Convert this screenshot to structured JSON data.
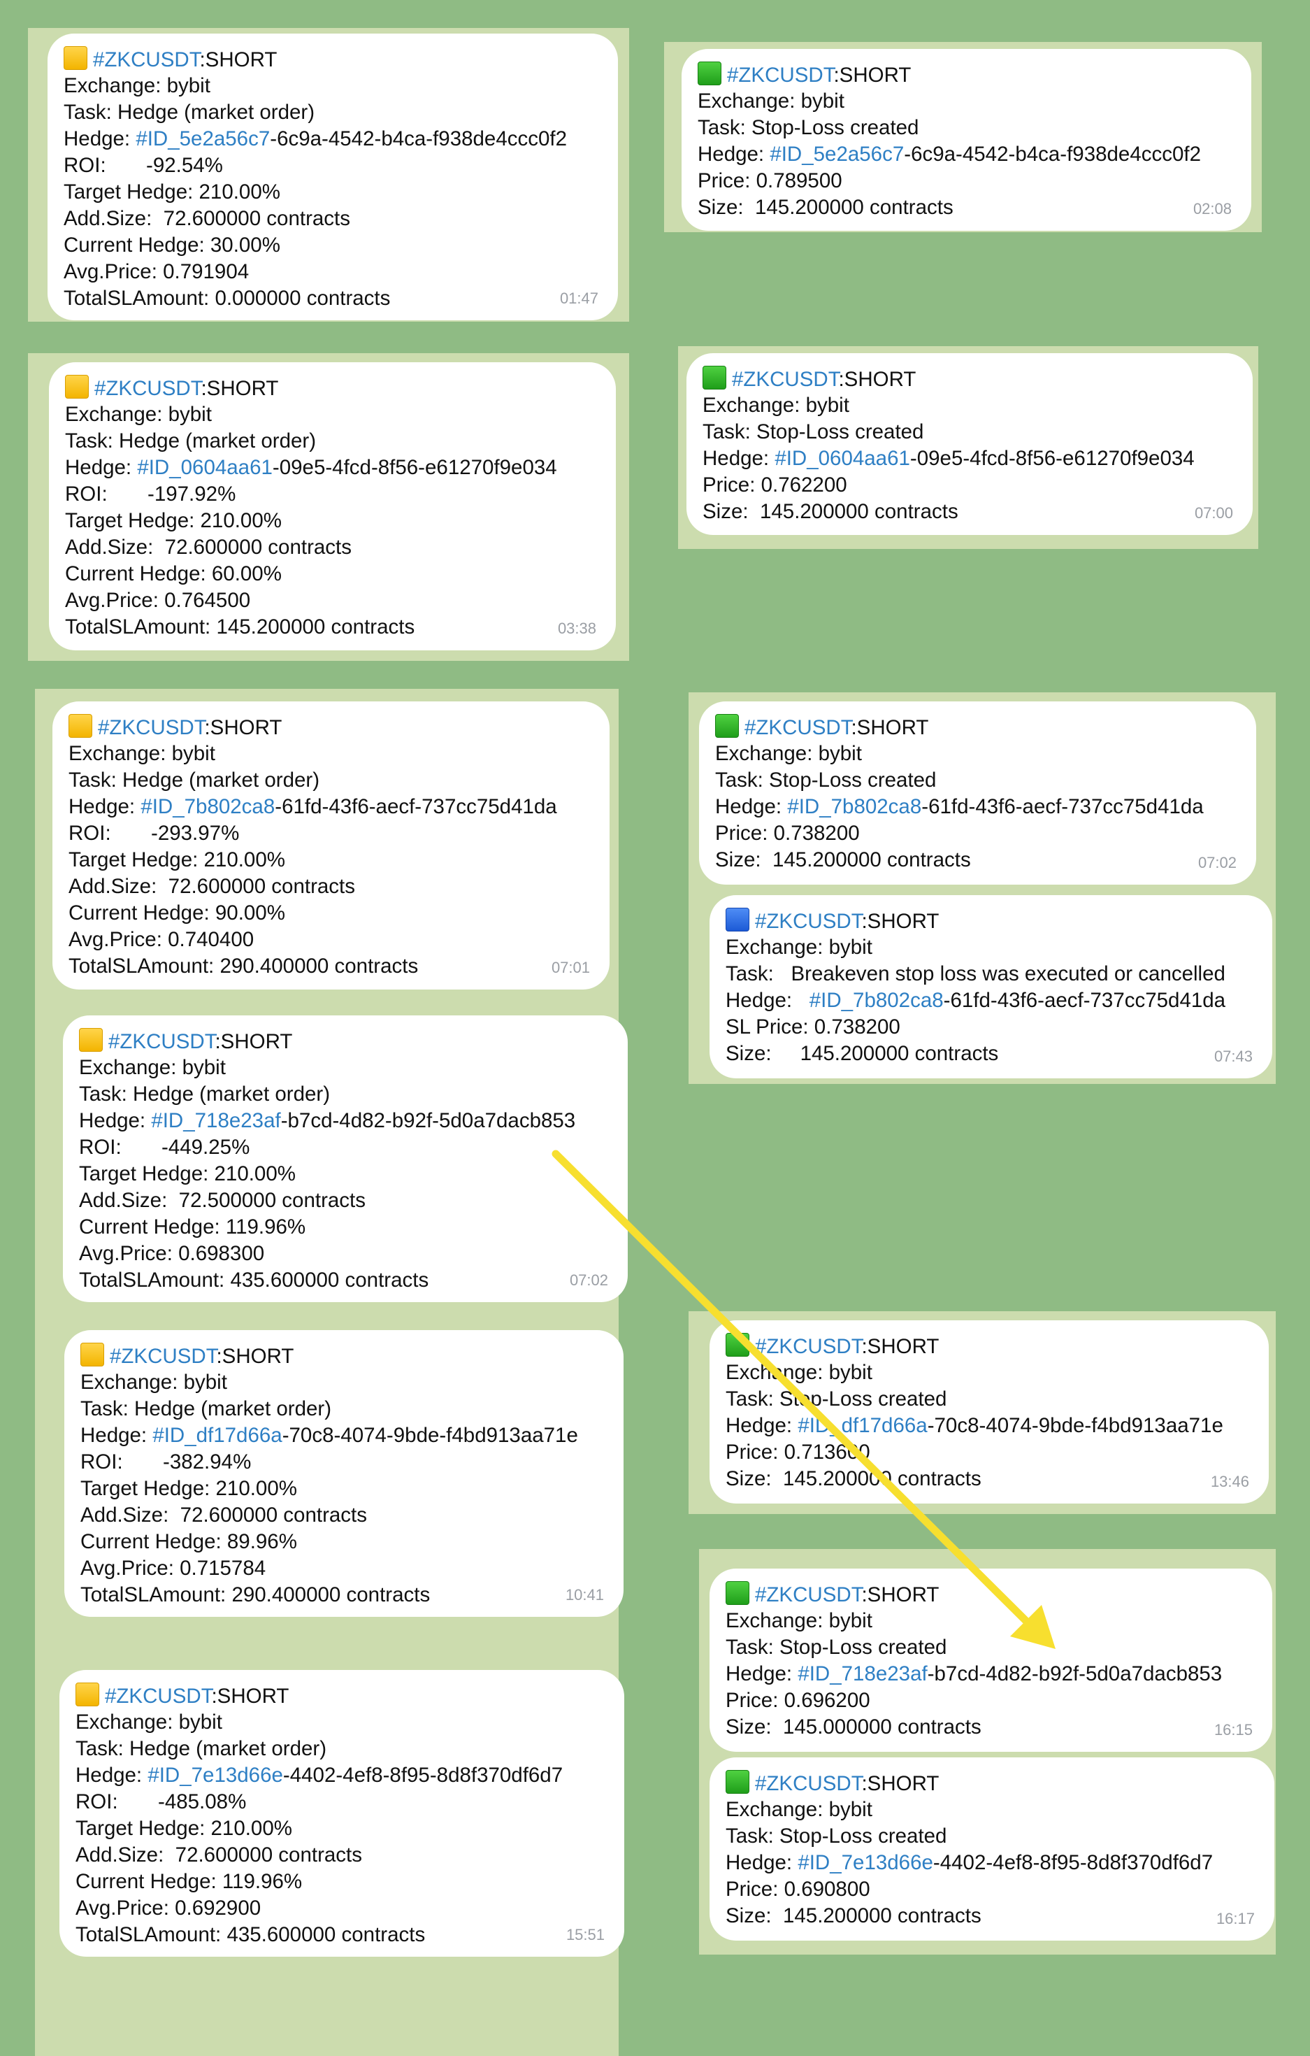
{
  "colors": {
    "background": "#8fbb84",
    "link": "#2e7fc4",
    "arrow": "#f7df2f",
    "yellow_square": "#f5c518",
    "green_square": "#2db51f",
    "blue_square": "#2a6ae3"
  },
  "messages": [
    {
      "icon": "yellow-square-icon",
      "tag": "#ZKCUSDT",
      "side": ":SHORT",
      "lines": [
        {
          "text": "Exchange: bybit"
        },
        {
          "text": "Task: Hedge (market order)"
        },
        {
          "prefix": "Hedge: ",
          "id": "#ID_5e2a56c7",
          "rest": "-6c9a-4542-b4ca-f938de4ccc0f2"
        },
        {
          "text": "ROI:       -92.54%"
        },
        {
          "text": "Target Hedge: 210.00%"
        },
        {
          "text": "Add.Size:  72.600000 contracts"
        },
        {
          "text": "Current Hedge: 30.00%"
        },
        {
          "text": "Avg.Price: 0.791904"
        },
        {
          "text": "TotalSLAmount: 0.000000 contracts"
        }
      ],
      "time": "01:47"
    },
    {
      "icon": "green-square-icon",
      "tag": "#ZKCUSDT",
      "side": ":SHORT",
      "lines": [
        {
          "text": "Exchange: bybit"
        },
        {
          "text": "Task: Stop-Loss created"
        },
        {
          "prefix": "Hedge: ",
          "id": "#ID_5e2a56c7",
          "rest": "-6c9a-4542-b4ca-f938de4ccc0f2"
        },
        {
          "text": "Price: 0.789500"
        },
        {
          "text": "Size:  145.200000 contracts"
        }
      ],
      "time": "02:08"
    },
    {
      "icon": "yellow-square-icon",
      "tag": "#ZKCUSDT",
      "side": ":SHORT",
      "lines": [
        {
          "text": "Exchange: bybit"
        },
        {
          "text": "Task: Hedge (market order)"
        },
        {
          "prefix": "Hedge: ",
          "id": "#ID_0604aa61",
          "rest": "-09e5-4fcd-8f56-e61270f9e034"
        },
        {
          "text": "ROI:       -197.92%"
        },
        {
          "text": "Target Hedge: 210.00%"
        },
        {
          "text": "Add.Size:  72.600000 contracts"
        },
        {
          "text": "Current Hedge: 60.00%"
        },
        {
          "text": "Avg.Price: 0.764500"
        },
        {
          "text": "TotalSLAmount: 145.200000 contracts"
        }
      ],
      "time": "03:38"
    },
    {
      "icon": "green-square-icon",
      "tag": "#ZKCUSDT",
      "side": ":SHORT",
      "lines": [
        {
          "text": "Exchange: bybit"
        },
        {
          "text": "Task: Stop-Loss created"
        },
        {
          "prefix": "Hedge: ",
          "id": "#ID_0604aa61",
          "rest": "-09e5-4fcd-8f56-e61270f9e034"
        },
        {
          "text": "Price: 0.762200"
        },
        {
          "text": "Size:  145.200000 contracts"
        }
      ],
      "time": "07:00"
    },
    {
      "icon": "yellow-square-icon",
      "tag": "#ZKCUSDT",
      "side": ":SHORT",
      "lines": [
        {
          "text": "Exchange: bybit"
        },
        {
          "text": "Task: Hedge (market order)"
        },
        {
          "prefix": "Hedge: ",
          "id": "#ID_7b802ca8",
          "rest": "-61fd-43f6-aecf-737cc75d41da"
        },
        {
          "text": "ROI:       -293.97%"
        },
        {
          "text": "Target Hedge: 210.00%"
        },
        {
          "text": "Add.Size:  72.600000 contracts"
        },
        {
          "text": "Current Hedge: 90.00%"
        },
        {
          "text": "Avg.Price: 0.740400"
        },
        {
          "text": "TotalSLAmount: 290.400000 contracts"
        }
      ],
      "time": "07:01"
    },
    {
      "icon": "green-square-icon",
      "tag": "#ZKCUSDT",
      "side": ":SHORT",
      "lines": [
        {
          "text": "Exchange: bybit"
        },
        {
          "text": "Task: Stop-Loss created"
        },
        {
          "prefix": "Hedge: ",
          "id": "#ID_7b802ca8",
          "rest": "-61fd-43f6-aecf-737cc75d41da"
        },
        {
          "text": "Price: 0.738200"
        },
        {
          "text": "Size:  145.200000 contracts"
        }
      ],
      "time": "07:02"
    },
    {
      "icon": "blue-square-icon",
      "tag": "#ZKCUSDT",
      "side": ":SHORT",
      "lines": [
        {
          "text": "Exchange: bybit"
        },
        {
          "text": "Task:   Breakeven stop loss was executed or cancelled"
        },
        {
          "prefix": "Hedge:   ",
          "id": "#ID_7b802ca8",
          "rest": "-61fd-43f6-aecf-737cc75d41da"
        },
        {
          "text": "SL Price: 0.738200"
        },
        {
          "text": "Size:     145.200000 contracts"
        }
      ],
      "time": "07:43"
    },
    {
      "icon": "yellow-square-icon",
      "tag": "#ZKCUSDT",
      "side": ":SHORT",
      "lines": [
        {
          "text": "Exchange: bybit"
        },
        {
          "text": "Task: Hedge (market order)"
        },
        {
          "prefix": "Hedge: ",
          "id": "#ID_718e23af",
          "rest": "-b7cd-4d82-b92f-5d0a7dacb853"
        },
        {
          "text": "ROI:       -449.25%"
        },
        {
          "text": "Target Hedge: 210.00%"
        },
        {
          "text": "Add.Size:  72.500000 contracts"
        },
        {
          "text": "Current Hedge: 119.96%"
        },
        {
          "text": "Avg.Price: 0.698300"
        },
        {
          "text": "TotalSLAmount: 435.600000 contracts"
        }
      ],
      "time": "07:02"
    },
    {
      "icon": "yellow-square-icon",
      "tag": "#ZKCUSDT",
      "side": ":SHORT",
      "lines": [
        {
          "text": "Exchange: bybit"
        },
        {
          "text": "Task: Hedge (market order)"
        },
        {
          "prefix": "Hedge: ",
          "id": "#ID_df17d66a",
          "rest": "-70c8-4074-9bde-f4bd913aa71e"
        },
        {
          "text": "ROI:       -382.94%"
        },
        {
          "text": "Target Hedge: 210.00%"
        },
        {
          "text": "Add.Size:  72.600000 contracts"
        },
        {
          "text": "Current Hedge: 89.96%"
        },
        {
          "text": "Avg.Price: 0.715784"
        },
        {
          "text": "TotalSLAmount: 290.400000 contracts"
        }
      ],
      "time": "10:41"
    },
    {
      "icon": "green-square-icon",
      "tag": "#ZKCUSDT",
      "side": ":SHORT",
      "lines": [
        {
          "text": "Exchange: bybit"
        },
        {
          "text": "Task: Stop-Loss created"
        },
        {
          "prefix": "Hedge: ",
          "id": "#ID_df17d66a",
          "rest": "-70c8-4074-9bde-f4bd913aa71e"
        },
        {
          "text": "Price: 0.713600"
        },
        {
          "text": "Size:  145.200000 contracts"
        }
      ],
      "time": "13:46"
    },
    {
      "icon": "green-square-icon",
      "tag": "#ZKCUSDT",
      "side": ":SHORT",
      "lines": [
        {
          "text": "Exchange: bybit"
        },
        {
          "text": "Task: Stop-Loss created"
        },
        {
          "prefix": "Hedge: ",
          "id": "#ID_718e23af",
          "rest": "-b7cd-4d82-b92f-5d0a7dacb853"
        },
        {
          "text": "Price: 0.696200"
        },
        {
          "text": "Size:  145.000000 contracts"
        }
      ],
      "time": "16:15"
    },
    {
      "icon": "yellow-square-icon",
      "tag": "#ZKCUSDT",
      "side": ":SHORT",
      "lines": [
        {
          "text": "Exchange: bybit"
        },
        {
          "text": "Task: Hedge (market order)"
        },
        {
          "prefix": "Hedge: ",
          "id": "#ID_7e13d66e",
          "rest": "-4402-4ef8-8f95-8d8f370df6d7"
        },
        {
          "text": "ROI:       -485.08%"
        },
        {
          "text": "Target Hedge: 210.00%"
        },
        {
          "text": "Add.Size:  72.600000 contracts"
        },
        {
          "text": "Current Hedge: 119.96%"
        },
        {
          "text": "Avg.Price: 0.692900"
        },
        {
          "text": "TotalSLAmount: 435.600000 contracts"
        }
      ],
      "time": "15:51"
    },
    {
      "icon": "green-square-icon",
      "tag": "#ZKCUSDT",
      "side": ":SHORT",
      "lines": [
        {
          "text": "Exchange: bybit"
        },
        {
          "text": "Task: Stop-Loss created"
        },
        {
          "prefix": "Hedge: ",
          "id": "#ID_7e13d66e",
          "rest": "-4402-4ef8-8f95-8d8f370df6d7"
        },
        {
          "text": "Price: 0.690800"
        },
        {
          "text": "Size:  145.200000 contracts"
        }
      ],
      "time": "16:17"
    }
  ]
}
